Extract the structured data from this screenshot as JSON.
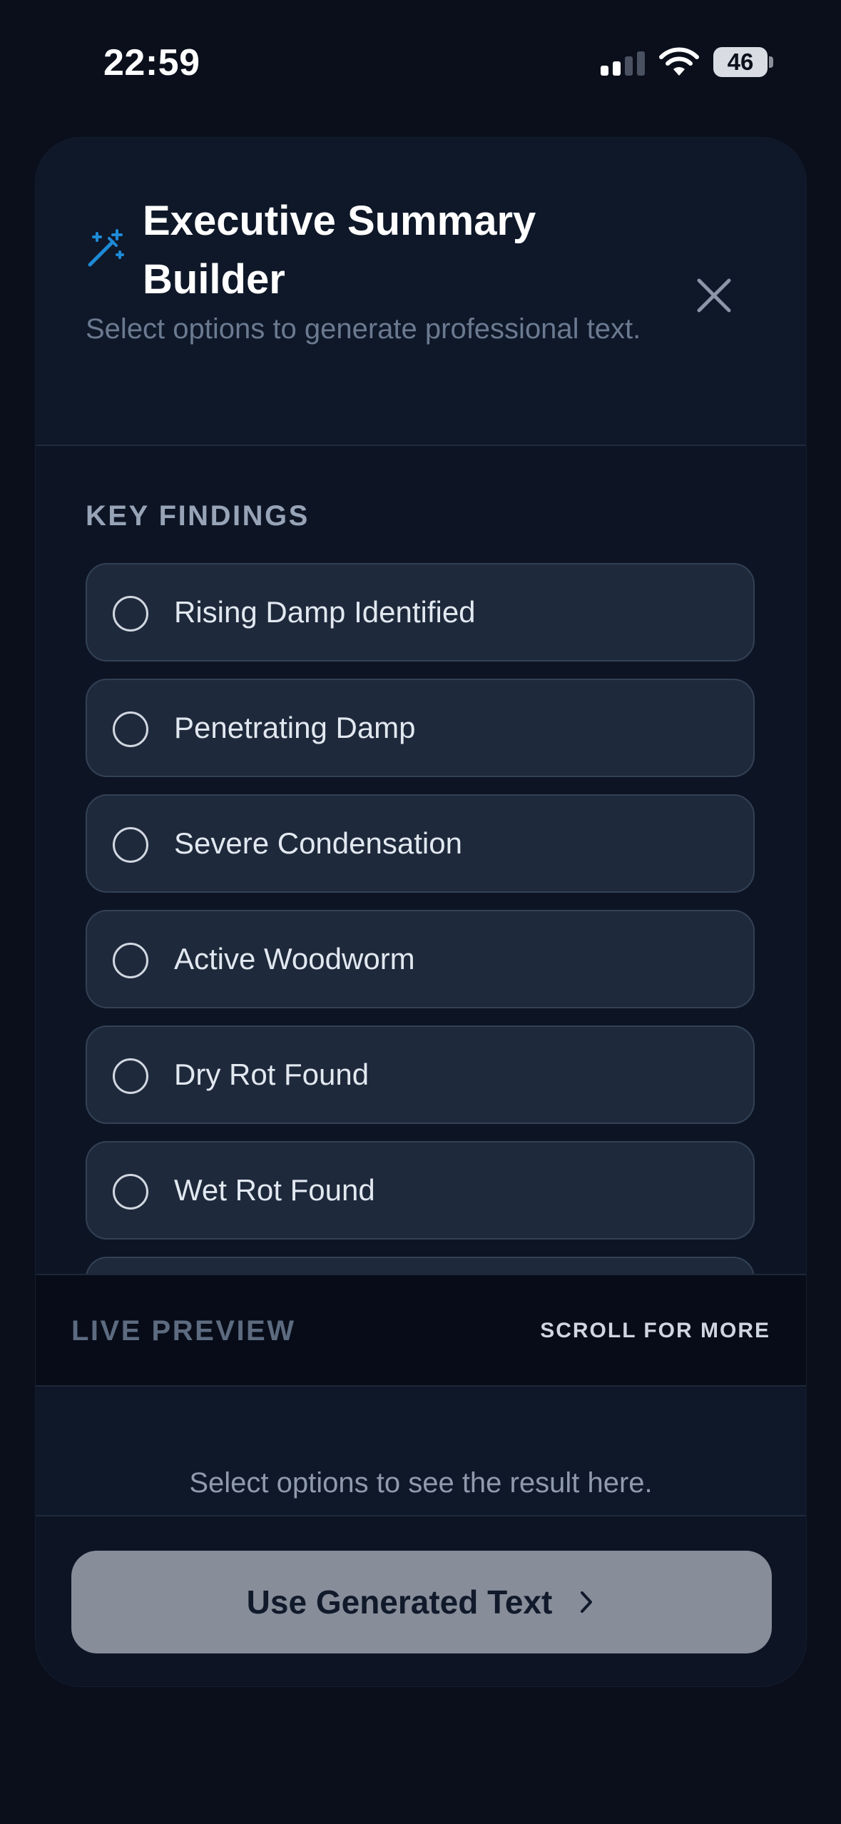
{
  "status_bar": {
    "time": "22:59",
    "battery": "46",
    "icons": [
      "signal-icon",
      "wifi-icon",
      "battery-icon"
    ]
  },
  "modal": {
    "title": "Executive Summary Builder",
    "subtitle": "Select options to generate professional text.",
    "title_icon": "magic-wand-icon",
    "close_icon": "close-icon",
    "accent_color": "#1e8ad6"
  },
  "key_findings": {
    "label": "KEY FINDINGS",
    "options": [
      {
        "label": "Rising Damp Identified",
        "selected": false
      },
      {
        "label": "Penetrating Damp",
        "selected": false
      },
      {
        "label": "Severe Condensation",
        "selected": false
      },
      {
        "label": "Active Woodworm",
        "selected": false
      },
      {
        "label": "Dry Rot Found",
        "selected": false
      },
      {
        "label": "Wet Rot Found",
        "selected": false
      }
    ]
  },
  "live_preview": {
    "label": "LIVE PREVIEW",
    "scroll_hint": "SCROLL FOR MORE",
    "placeholder": "Select options to see the result here."
  },
  "footer": {
    "button_label": "Use Generated Text",
    "button_icon": "chevron-right-icon"
  }
}
